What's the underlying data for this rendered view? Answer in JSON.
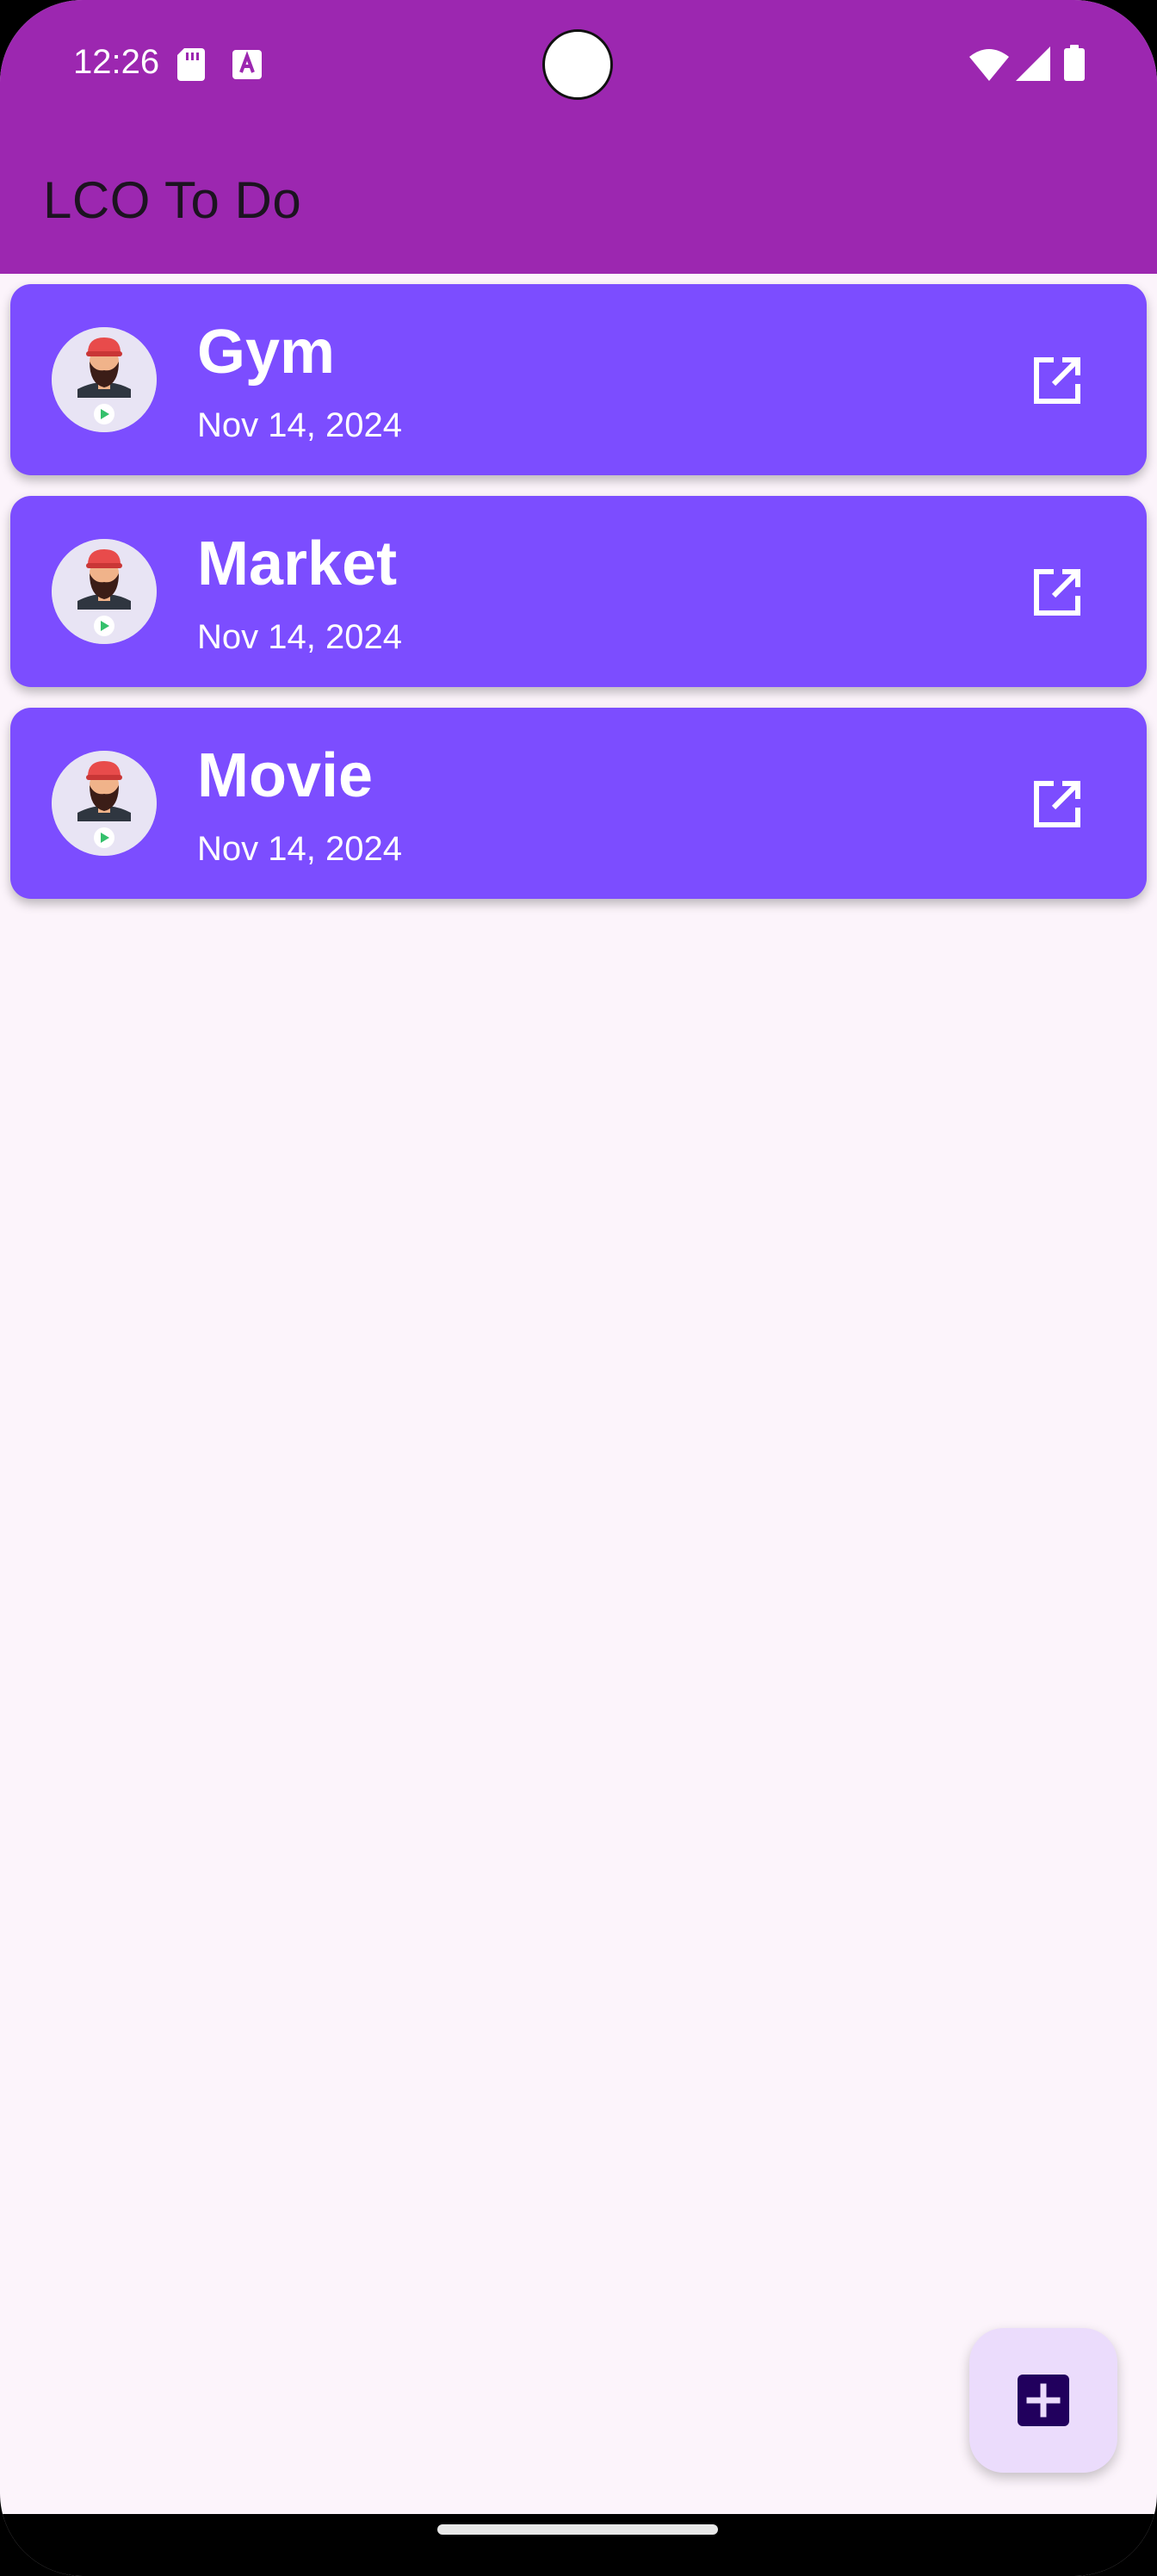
{
  "status_bar": {
    "time": "12:26",
    "icons": [
      "sd-card-icon",
      "text-a-icon",
      "wifi-icon",
      "cell-signal-icon",
      "battery-icon"
    ]
  },
  "app_bar": {
    "title": "LCO To Do"
  },
  "colors": {
    "app_bar": "#9c27b0",
    "card": "#7c4dff",
    "background": "#fcf4fb",
    "fab": "#ebdcfc",
    "fab_icon": "#21005d"
  },
  "todos": [
    {
      "title": "Gym",
      "date": "Nov 14, 2024",
      "icon": "open-in-new-icon"
    },
    {
      "title": "Market",
      "date": "Nov 14, 2024",
      "icon": "open-in-new-icon"
    },
    {
      "title": "Movie",
      "date": "Nov 14, 2024",
      "icon": "open-in-new-icon"
    }
  ],
  "fab": {
    "icon": "add-box-icon"
  }
}
